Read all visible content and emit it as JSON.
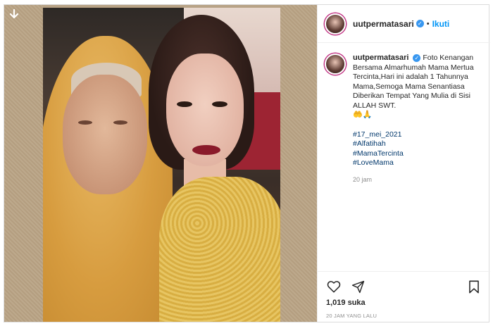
{
  "post": {
    "username": "uutpermatasari",
    "separator": "•",
    "follow_label": "Ikuti",
    "caption_text": "Foto Kenangan Bersama Almarhumah Mama Mertua Tercinta,Hari ini adalah 1 Tahunnya Mama,Semoga Mama Senantiasa Diberikan Tempat Yang Mulia di Sisi ALLAH SWT.",
    "caption_emoji": "🤲🙏",
    "hashtags": [
      "#17_mei_2021",
      "#Alfatihah",
      "#MamaTercinta",
      "#LoveMama"
    ],
    "caption_time": "20 jam",
    "likes": "1,019 suka",
    "post_time": "20 JAM YANG LALU"
  },
  "icons": {
    "download": "download-arrow-icon",
    "verified": "verified-badge-icon",
    "like": "heart-icon",
    "share": "paper-plane-icon",
    "save": "bookmark-icon"
  },
  "colors": {
    "link": "#0095f6",
    "hashtag": "#00376b",
    "muted": "#8e8e8e",
    "verified": "#3897f0"
  }
}
